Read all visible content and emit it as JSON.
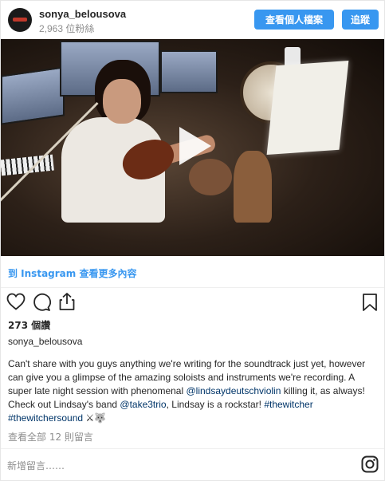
{
  "header": {
    "username": "sonya_belousova",
    "followers": "2,963 位粉絲",
    "view_profile_label": "查看個人檔案",
    "follow_label": "追蹤"
  },
  "media": {
    "type": "video",
    "play_icon": "play-icon"
  },
  "view_more_label": "到 Instagram 查看更多內容",
  "actions": {
    "icons": [
      "heart-icon",
      "comment-icon",
      "share-icon",
      "bookmark-icon"
    ]
  },
  "likes": "273 個讚",
  "caption": {
    "username": "sonya_belousova",
    "text_1": "Can't share with you guys anything we're writing for the soundtrack just yet, however can give you a glimpse of the amazing soloists and instruments we're recording. A super late night session with phenomenal ",
    "mention_1": "@lindsaydeutschviolin",
    "text_2": " killing it, as always! Check out Lindsay's band ",
    "mention_2": "@take3trio",
    "text_3": ", Lindsay is a rockstar! ",
    "hashtag_1": "#thewitcher",
    "hashtag_2": "#thewitchersound",
    "emojis": "⚔🐺"
  },
  "view_comments": "查看全部 12 則留言",
  "add_comment": {
    "placeholder": "新增留言……",
    "icon": "instagram-icon"
  },
  "colors": {
    "accent": "#3897f0",
    "link": "#003569",
    "muted": "#8e8e8e"
  }
}
